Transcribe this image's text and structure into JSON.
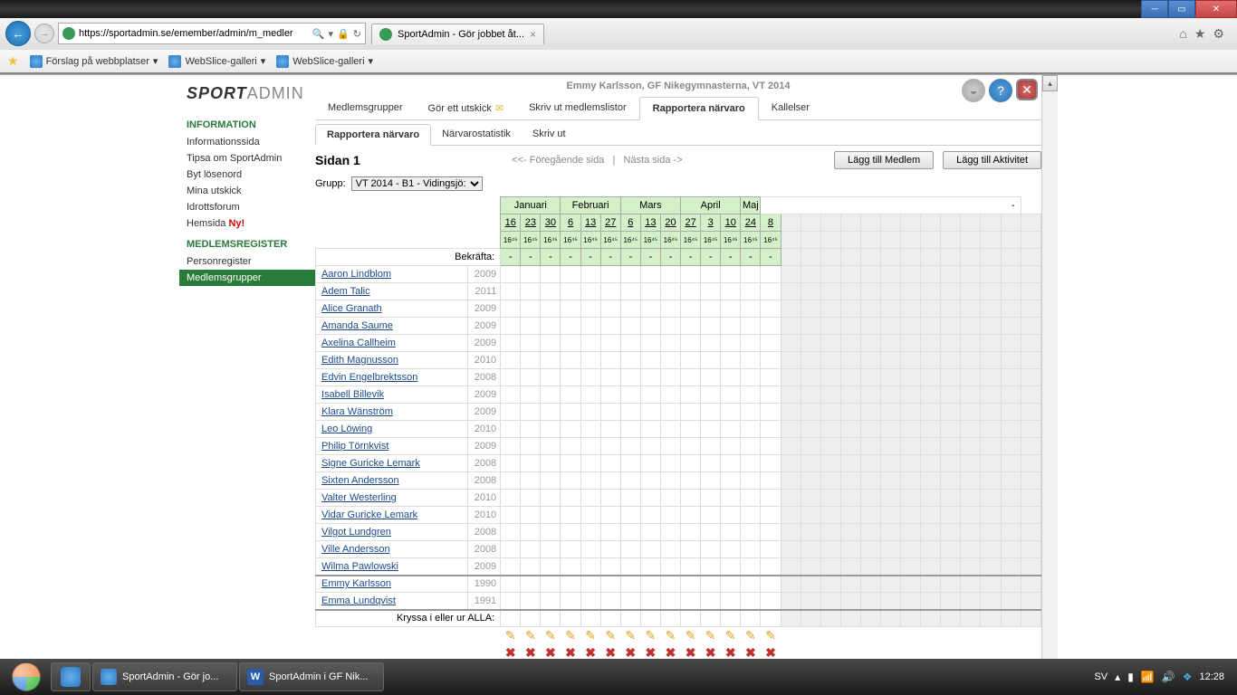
{
  "browser": {
    "url": "https://sportadmin.se/emember/admin/m_medler",
    "tab_title": "SportAdmin - Gör jobbet åt...",
    "favorites": [
      "Förslag på webbplatser",
      "WebSlice-galleri",
      "WebSlice-galleri"
    ]
  },
  "logo": {
    "part1": "SPORT",
    "part2": "ADMIN"
  },
  "user_line": "Emmy Karlsson, GF Nikegymnasterna, VT 2014",
  "sidebar": {
    "info_head": "INFORMATION",
    "info_links": [
      "Informationssida",
      "Tipsa om SportAdmin",
      "Byt lösenord",
      "Mina utskick",
      "Idrottsforum"
    ],
    "hemsida": "Hemsida",
    "ny": "Ny!",
    "reg_head": "MEDLEMSREGISTER",
    "reg_links": [
      "Personregister",
      "Medlemsgrupper"
    ]
  },
  "main_tabs": [
    "Medlemsgrupper",
    "Gör ett utskick",
    "Skriv ut medlemslistor",
    "Rapportera närvaro",
    "Kallelser"
  ],
  "sub_tabs": [
    "Rapportera närvaro",
    "Närvarostatistik",
    "Skriv ut"
  ],
  "page_title": "Sidan 1",
  "pager": {
    "prev": "<<- Föregående sida",
    "sep": "|",
    "next": "Nästa sida ->"
  },
  "buttons": {
    "add_member": "Lägg till Medlem",
    "add_activity": "Lägg till Aktivitet"
  },
  "group_label": "Grupp:",
  "group_value": "VT 2014 - B1 - Vidingsjö:",
  "months": [
    {
      "name": "Januari",
      "span": 3
    },
    {
      "name": "Februari",
      "span": 3
    },
    {
      "name": "Mars",
      "span": 3
    },
    {
      "name": "April",
      "span": 3
    },
    {
      "name": "Maj",
      "span": 1
    }
  ],
  "days": [
    "16",
    "23",
    "30",
    "6",
    "13",
    "27",
    "6",
    "13",
    "20",
    "27",
    "3",
    "10",
    "24",
    "8"
  ],
  "time": "16⁴⁵",
  "confirm_label": "Bekräfta:",
  "members": [
    {
      "name": "Aaron Lindblom",
      "year": "2009"
    },
    {
      "name": "Adem Talic",
      "year": "2011"
    },
    {
      "name": "Alice Granath",
      "year": "2009"
    },
    {
      "name": "Amanda Saume",
      "year": "2009"
    },
    {
      "name": "Axelina Callheim",
      "year": "2009"
    },
    {
      "name": "Edith Magnusson",
      "year": "2010"
    },
    {
      "name": "Edvin Engelbrektsson",
      "year": "2008"
    },
    {
      "name": "Isabell Billevik",
      "year": "2009"
    },
    {
      "name": "Klara Wänström",
      "year": "2009"
    },
    {
      "name": "Leo Löwing",
      "year": "2010"
    },
    {
      "name": "Philip Törnkvist",
      "year": "2009"
    },
    {
      "name": "Signe Guricke Lemark",
      "year": "2008"
    },
    {
      "name": "Sixten Andersson",
      "year": "2008"
    },
    {
      "name": "Valter Westerling",
      "year": "2010"
    },
    {
      "name": "Vidar Guricke Lemark",
      "year": "2010"
    },
    {
      "name": "Vilgot Lundgren",
      "year": "2008"
    },
    {
      "name": "Ville Andersson",
      "year": "2008"
    },
    {
      "name": "Wilma Pawlowski",
      "year": "2009"
    }
  ],
  "leaders": [
    {
      "name": "Emmy Karlsson",
      "year": "1990"
    },
    {
      "name": "Emma Lundqvist",
      "year": "1991"
    }
  ],
  "check_all": "Kryssa i eller ur ALLA:",
  "extra_dash": "-",
  "taskbar": {
    "ie_task": "SportAdmin - Gör jo...",
    "word_task": "SportAdmin i GF Nik...",
    "lang": "SV",
    "time": "12:28"
  }
}
